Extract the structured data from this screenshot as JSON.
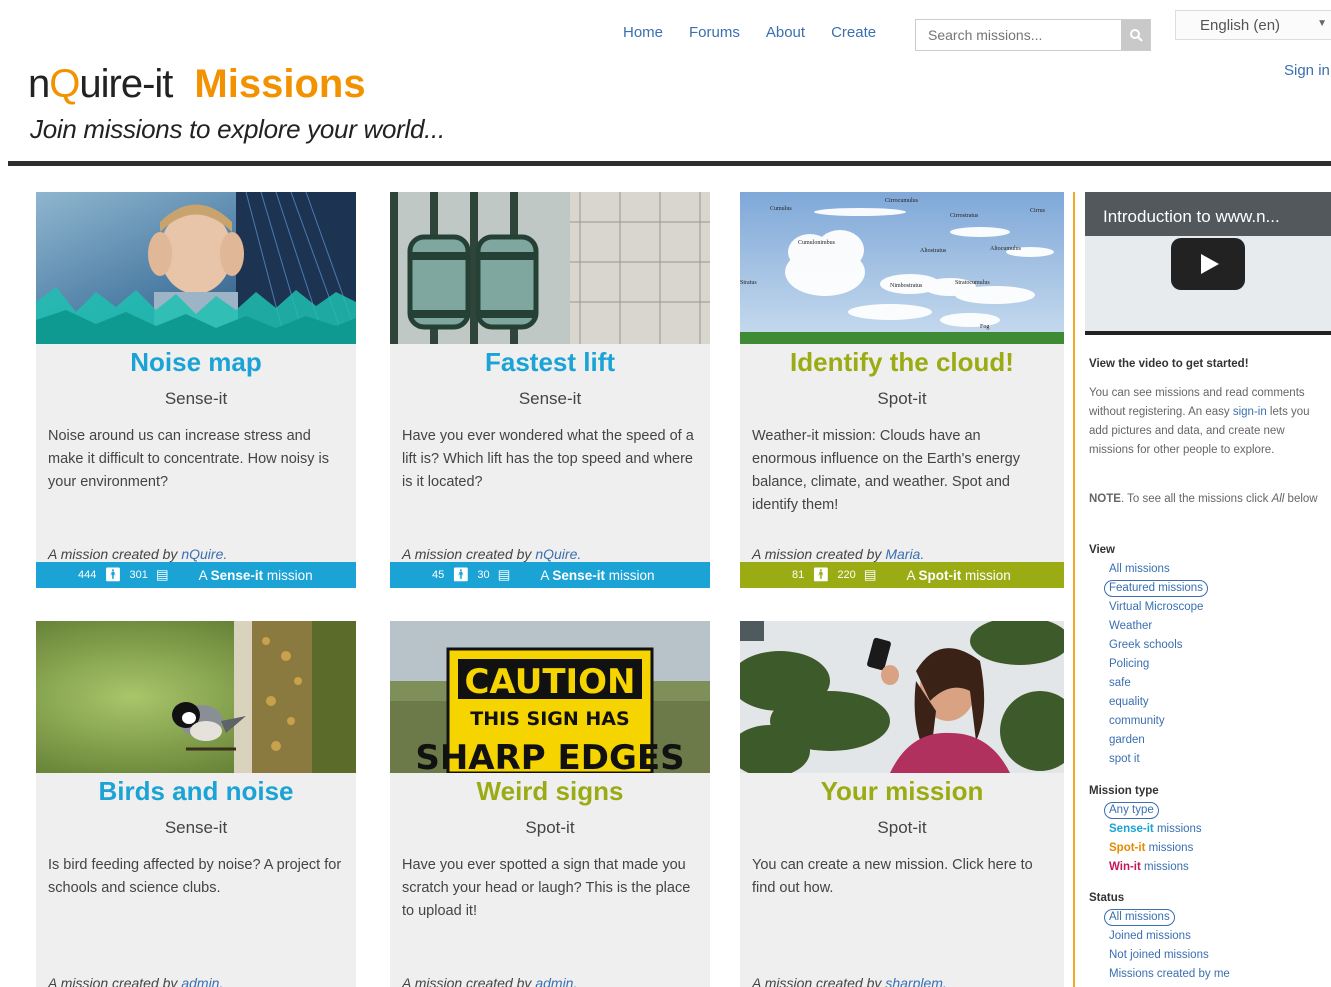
{
  "nav": {
    "links": [
      "Home",
      "Forums",
      "About",
      "Create"
    ],
    "search_placeholder": "Search missions...",
    "language": "English (en)",
    "signin": "Sign in"
  },
  "brand": {
    "logo_n": "n",
    "logo_q": "Q",
    "logo_rest": "uire-it",
    "missions": "Missions",
    "tagline": "Join missions to explore your world..."
  },
  "colors": {
    "sense": "#1ba3d6",
    "spot": "#9aab13",
    "accent": "#f39200"
  },
  "missions": [
    {
      "title": "Noise map",
      "type": "Sense-it",
      "description": "Noise around us can increase stress and make it difficult to concentrate. How noisy is your environment?",
      "creator_prefix": "A mission created by ",
      "creator": "nQuire.",
      "members": "444",
      "contributions": "301",
      "bar_prefix": "A ",
      "bar_kind": "Sense-it",
      "bar_suffix": " mission"
    },
    {
      "title": "Fastest lift",
      "type": "Sense-it",
      "description": "Have you ever wondered what the speed of a lift is? Which lift has the top speed and where is it located?",
      "creator_prefix": "A mission created by ",
      "creator": "nQuire.",
      "members": "45",
      "contributions": "30",
      "bar_prefix": "A ",
      "bar_kind": "Sense-it",
      "bar_suffix": " mission"
    },
    {
      "title": "Identify the cloud!",
      "type": "Spot-it",
      "description": "Weather-it mission: Clouds have an enormous influence on the Earth's energy balance, climate, and weather. Spot and identify them!",
      "creator_prefix": "A mission created by ",
      "creator": "Maria.",
      "members": "81",
      "contributions": "220",
      "bar_prefix": "A ",
      "bar_kind": "Spot-it",
      "bar_suffix": " mission"
    },
    {
      "title": "Birds and noise",
      "type": "Sense-it",
      "description": "Is bird feeding affected by noise? A project for schools and science clubs.",
      "creator_prefix": "A mission created by ",
      "creator": "admin."
    },
    {
      "title": "Weird signs",
      "type": "Spot-it",
      "description": "Have you ever spotted a sign that made you scratch your head or laugh? This is the place to upload it!",
      "creator_prefix": "A mission created by ",
      "creator": "admin."
    },
    {
      "title": "Your mission",
      "type": "Spot-it",
      "description": "You can create a new mission. Click here to find out how.",
      "creator_prefix": "A mission created by ",
      "creator": "sharplem."
    }
  ],
  "cloud_labels": [
    "Cumulus",
    "Cirrocumulus",
    "Cirrostratus",
    "Cirrus",
    "Cumulonimbus",
    "Altostratus",
    "Altocumulus",
    "Stratus",
    "Stratocumulus",
    "Nimbostratus",
    "Fog"
  ],
  "caution_sign": {
    "line1": "CAUTION",
    "line2": "THIS SIGN HAS",
    "line3": "SHARP EDGES"
  },
  "sidebar": {
    "video_title": "Introduction to www.n...",
    "video_heading": "View the video to get started!",
    "intro_1": "You can see missions and read comments without registering. An easy ",
    "intro_link": "sign-in",
    "intro_2": " lets you add pictures and data, and create new missions for other people to explore.",
    "note_label": "NOTE",
    "note_text": ". To see all the missions click ",
    "note_em": "All",
    "note_end": " below",
    "view_heading": "View",
    "view_items": [
      "All missions",
      "Featured missions",
      "Virtual Microscope",
      "Weather",
      "Greek schools",
      "Policing",
      "safe",
      "equality",
      "community",
      "garden",
      "spot it"
    ],
    "type_heading": "Mission type",
    "type_any": "Any type",
    "type_items": [
      {
        "kind": "Sense-it",
        "rest": " missions"
      },
      {
        "kind": "Spot-it",
        "rest": " missions"
      },
      {
        "kind": "Win-it",
        "rest": " missions"
      }
    ],
    "status_heading": "Status",
    "status_items": [
      "All missions",
      "Joined missions",
      "Not joined missions",
      "Missions created by me"
    ]
  }
}
